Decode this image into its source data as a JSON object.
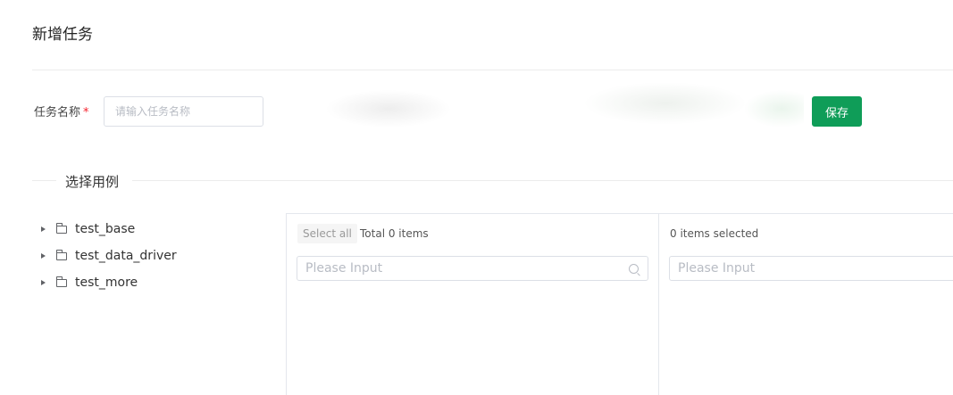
{
  "header": {
    "title": "新增任务"
  },
  "form": {
    "name_label": "任务名称",
    "required_mark": "*",
    "name_placeholder": "请输入任务名称",
    "name_value": "",
    "save_label": "保存"
  },
  "section": {
    "title": "选择用例"
  },
  "tree": {
    "nodes": [
      {
        "label": "test_base",
        "icon": "folder-icon"
      },
      {
        "label": "test_data_driver",
        "icon": "folder-icon"
      },
      {
        "label": "test_more",
        "icon": "folder-icon"
      }
    ]
  },
  "transfer": {
    "left": {
      "select_all_label": "Select all",
      "total_label": "Total 0 items",
      "search_placeholder": "Please Input"
    },
    "right": {
      "selected_label": "0 items selected",
      "search_placeholder": "Please Input"
    }
  },
  "colors": {
    "accent": "#0f9d58",
    "required": "#f5222d",
    "border": "#dcdfe6"
  }
}
